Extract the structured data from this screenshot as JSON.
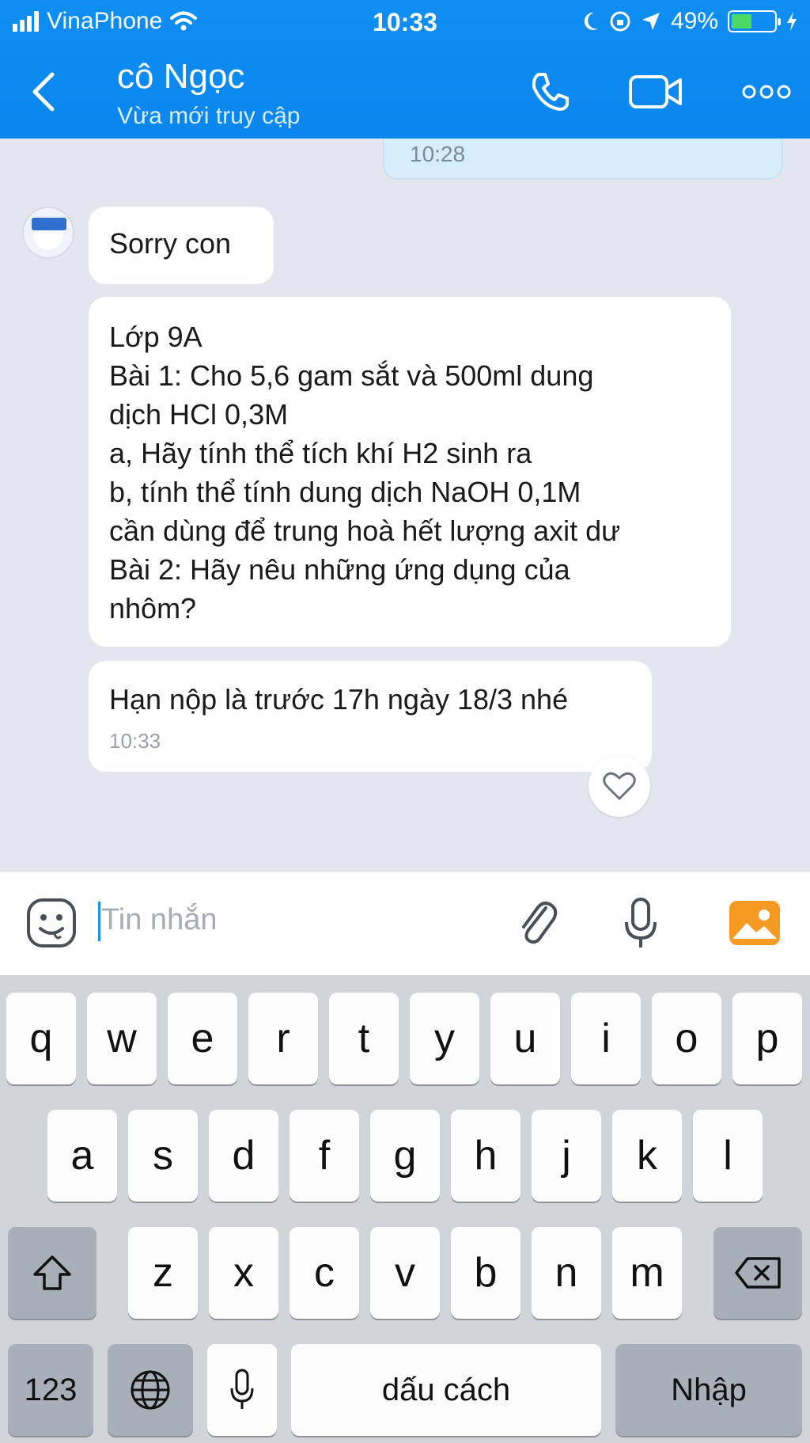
{
  "status_bar": {
    "carrier": "VinaPhone",
    "time": "10:33",
    "battery": "49%",
    "battery_level": 0.49
  },
  "header": {
    "contact_name": "cô Ngọc",
    "contact_status": "Vừa mới truy cập",
    "icons": [
      "back-arrow-icon",
      "phone-icon",
      "video-camera-icon",
      "more-icon"
    ]
  },
  "chat": {
    "sent_message_time": "10:28",
    "messages": [
      {
        "lines": [
          "Sorry con"
        ]
      },
      {
        "lines": [
          "Lớp 9A",
          "Bài 1: Cho 5,6 gam sắt và 500ml dung",
          "dịch HCl 0,3M",
          "a, Hãy tính thể tích khí H2 sinh ra",
          "b, tính thể tính dung dịch NaOH 0,1M",
          "cần dùng để trung hoà hết lượng axit dư",
          "Bài 2: Hãy nêu những ứng dụng của",
          "nhôm?"
        ]
      },
      {
        "lines": [
          "Hạn nộp là trước 17h ngày 18/3 nhé"
        ],
        "time": "10:33"
      }
    ]
  },
  "input": {
    "placeholder": "Tin nhắn",
    "icons": [
      "emoji-icon",
      "paperclip-icon",
      "microphone-icon",
      "image-icon"
    ]
  },
  "keyboard": {
    "row1": [
      "q",
      "w",
      "e",
      "r",
      "t",
      "y",
      "u",
      "i",
      "o",
      "p"
    ],
    "row2": [
      "a",
      "s",
      "d",
      "f",
      "g",
      "h",
      "j",
      "k",
      "l"
    ],
    "row3": [
      "z",
      "x",
      "c",
      "v",
      "b",
      "n",
      "m"
    ],
    "numbers_key": "123",
    "space_key": "dấu cách",
    "return_key": "Nhập"
  }
}
